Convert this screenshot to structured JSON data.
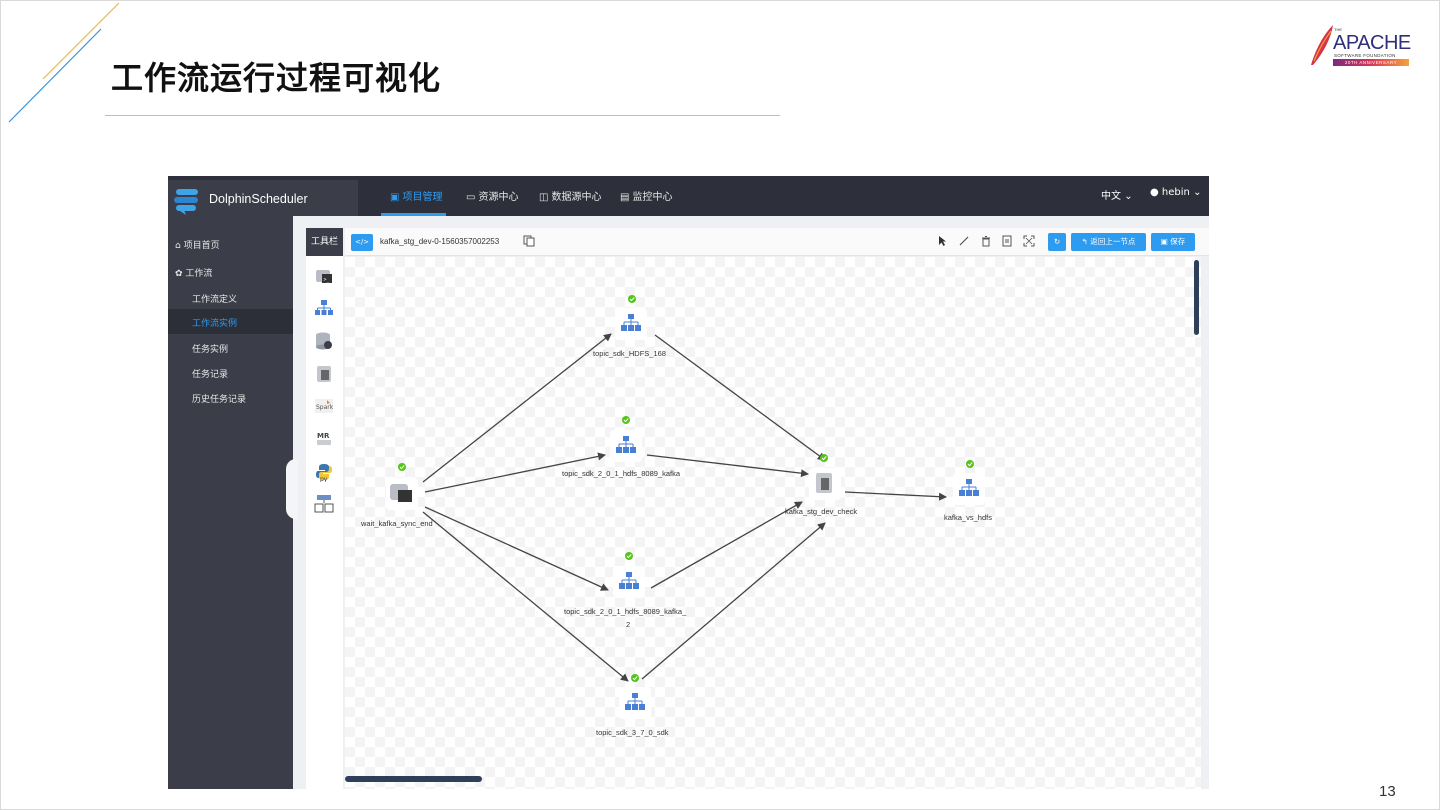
{
  "slide": {
    "title": "工作流运行过程可视化",
    "page_number": "13",
    "logo": {
      "the": "THE",
      "word": "APACHE",
      "sub": "SOFTWARE FOUNDATION",
      "anniversary": "20TH ANNIVERSARY"
    }
  },
  "app": {
    "brand": "DolphinScheduler",
    "nav": [
      {
        "label": "项目管理",
        "icon": "project-icon",
        "active": true
      },
      {
        "label": "资源中心",
        "icon": "folder-icon",
        "active": false
      },
      {
        "label": "数据源中心",
        "icon": "database-icon",
        "active": false
      },
      {
        "label": "监控中心",
        "icon": "monitor-icon",
        "active": false
      }
    ],
    "language": "中文",
    "user": "hebin",
    "sidebar": {
      "items": [
        {
          "label": "项目首页",
          "icon": "home-icon"
        },
        {
          "label": "工作流",
          "icon": "gear-icon"
        },
        {
          "label": "工作流定义"
        },
        {
          "label": "工作流实例",
          "active": true
        },
        {
          "label": "任务实例"
        },
        {
          "label": "任务记录"
        },
        {
          "label": "历史任务记录"
        }
      ]
    },
    "toolbox": {
      "title": "工具栏",
      "tools": [
        "shell-task-icon",
        "sub-process-icon",
        "procedure-icon",
        "sql-icon",
        "spark-icon",
        "mr-icon",
        "python-icon",
        "dependent-icon"
      ]
    },
    "canvas_header": {
      "code_button": "</>",
      "workflow_name": "kafka_stg_dev-0-1560357002253",
      "back_button": "返回上一节点",
      "save_button": "保存"
    },
    "nodes": [
      {
        "label": "wait_kafka_sync_end",
        "status": "success"
      },
      {
        "label": "topic_sdk_HDFS_168",
        "status": "success"
      },
      {
        "label": "topic_sdk_2_0_1_hdfs_8089_kafka",
        "status": "success"
      },
      {
        "label": "topic_sdk_2_0_1_hdfs_8089_kafka_",
        "label2": "2",
        "status": "success"
      },
      {
        "label": "topic_sdk_3_7_0_sdk",
        "status": "success"
      },
      {
        "label": "kafka_stg_dev_check",
        "status": "success"
      },
      {
        "label": "kafka_vs_hdfs",
        "status": "success"
      }
    ],
    "colors": {
      "accent": "#2d9bf0",
      "topbar": "#2d303a",
      "sidebar": "#3b3e48",
      "success": "#52c41a"
    }
  }
}
